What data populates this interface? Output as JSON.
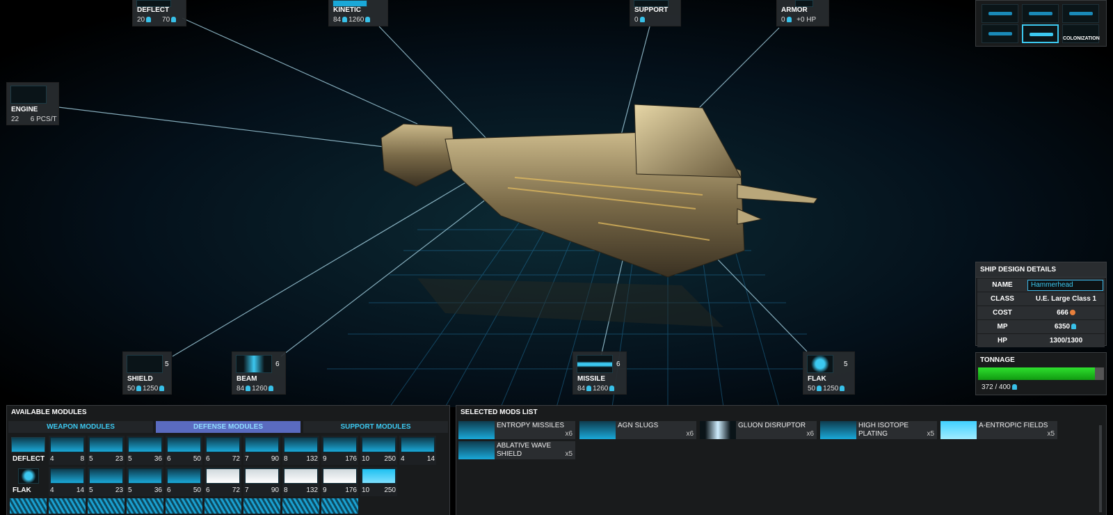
{
  "callouts": [
    {
      "key": "deflect",
      "name": "DEFLECT",
      "a": "20",
      "b": "70"
    },
    {
      "key": "kinetic",
      "name": "KINETIC",
      "a": "84",
      "b": "1260"
    },
    {
      "key": "support",
      "name": "SUPPORT",
      "a": "0"
    },
    {
      "key": "armor",
      "name": "ARMOR",
      "a": "0",
      "b": "+0 HP"
    },
    {
      "key": "engine",
      "name": "ENGINE",
      "a": "22",
      "b": "6 PCS/T"
    },
    {
      "key": "shield",
      "name": "SHIELD",
      "a": "50",
      "b": "1250",
      "count": "5"
    },
    {
      "key": "beam",
      "name": "BEAM",
      "a": "84",
      "b": "1260",
      "count": "6"
    },
    {
      "key": "missile",
      "name": "MISSILE",
      "a": "84",
      "b": "1260",
      "count": "6"
    },
    {
      "key": "flak",
      "name": "FLAK",
      "a": "50",
      "b": "1250",
      "count": "5"
    }
  ],
  "ship_selector": {
    "colonization_label": "COLONIZATION"
  },
  "design_details": {
    "title": "SHIP DESIGN DETAILS",
    "name_label": "NAME",
    "name_value": "Hammerhead",
    "class_label": "CLASS",
    "class_value": "U.E. Large Class 1",
    "cost_label": "COST",
    "cost_value": "666",
    "mp_label": "MP",
    "mp_value": "6350",
    "hp_label": "HP",
    "hp_value": "1300/1300"
  },
  "tonnage": {
    "title": "TONNAGE",
    "text": "372 / 400",
    "used": 372,
    "max": 400
  },
  "available": {
    "title": "AVAILABLE MODULES",
    "tabs": [
      "WEAPON MODULES",
      "DEFENSE MODULES",
      "SUPPORT MODULES"
    ],
    "active_tab": 1,
    "deflect_label": "DEFLECT",
    "flak_label": "FLAK",
    "deflect": [
      {
        "a": "4",
        "b": "8"
      },
      {
        "a": "5",
        "b": "23"
      },
      {
        "a": "5",
        "b": "36"
      },
      {
        "a": "6",
        "b": "50"
      },
      {
        "a": "6",
        "b": "72"
      },
      {
        "a": "7",
        "b": "90"
      },
      {
        "a": "8",
        "b": "132"
      },
      {
        "a": "9",
        "b": "176"
      },
      {
        "a": "10",
        "b": "250"
      },
      {
        "a": "4",
        "b": "14"
      }
    ],
    "flak": [
      {
        "a": "4",
        "b": "14"
      },
      {
        "a": "5",
        "b": "23"
      },
      {
        "a": "5",
        "b": "36"
      },
      {
        "a": "6",
        "b": "50"
      },
      {
        "a": "6",
        "b": "72"
      },
      {
        "a": "7",
        "b": "90"
      },
      {
        "a": "8",
        "b": "132"
      },
      {
        "a": "9",
        "b": "176"
      },
      {
        "a": "10",
        "b": "250"
      }
    ]
  },
  "selected": {
    "title": "SELECTED MODS LIST",
    "items": [
      {
        "name": "ENTROPY MISSILES",
        "qty": "x6"
      },
      {
        "name": "AGN SLUGS",
        "qty": "x6"
      },
      {
        "name": "GLUON DISRUPTOR",
        "qty": "x6"
      },
      {
        "name": "HIGH ISOTOPE PLATING",
        "qty": "x5"
      },
      {
        "name": "A-ENTROPIC FIELDS",
        "qty": "x5"
      },
      {
        "name": "ABLATIVE WAVE SHIELD",
        "qty": "x5"
      }
    ]
  }
}
